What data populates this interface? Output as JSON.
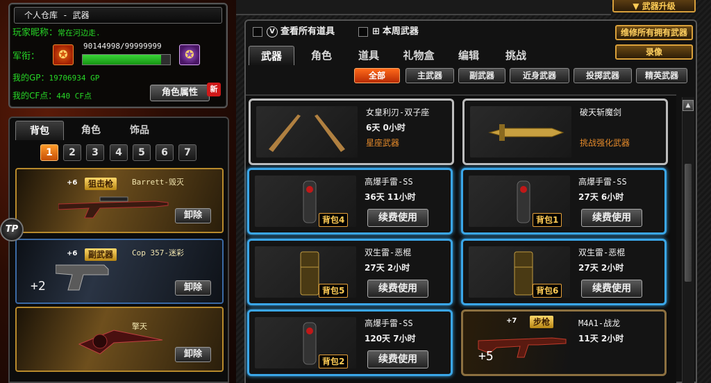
{
  "player": {
    "window_title": "个人仓库 - 武器",
    "nick_label": "玩家昵称：",
    "nick_value": "常在河边走.",
    "rank_label": "军衔：",
    "exp_text": "90144998/99999999",
    "exp_progress": 0.9,
    "gp_label": "我的GP：",
    "gp_value": "19706934 GP",
    "cf_label": "我的CF点：",
    "cf_value": "440 CF点",
    "role_button": "角色属性",
    "new_badge": "新"
  },
  "bag": {
    "tabs": [
      "背包",
      "角色",
      "饰品"
    ],
    "active_tab": 0,
    "pages": [
      "1",
      "2",
      "3",
      "4",
      "5",
      "6",
      "7"
    ],
    "active_page": 0,
    "tp_label": "TP",
    "slots": [
      {
        "plus": "+6",
        "tag": "狙击枪",
        "name": "Barrett-毁灭",
        "unload": "卸除",
        "extra": ""
      },
      {
        "plus": "+6",
        "tag": "副武器",
        "name": "Cop 357-迷彩",
        "unload": "卸除",
        "extra": "+2"
      },
      {
        "plus": "",
        "tag": "",
        "name": "擎天",
        "unload": "卸除",
        "extra": ""
      }
    ]
  },
  "header": {
    "top_button": "武器升级",
    "view_all": "查看所有道具",
    "weekly_weapon": "本周武器",
    "repair_all": "维修所有拥有武器",
    "record": "录像"
  },
  "main_tabs": [
    "武器",
    "角色",
    "道具",
    "礼物盒",
    "编辑",
    "挑战"
  ],
  "active_main_tab": 0,
  "filters": [
    "全部",
    "主武器",
    "副武器",
    "近身武器",
    "投掷武器",
    "精英武器"
  ],
  "active_filter": 0,
  "items": [
    {
      "name": "女皇利刃-双子座",
      "time": "6天  0小时",
      "sub": "星座武器",
      "style": "gray",
      "badge": "",
      "renew": ""
    },
    {
      "name": "破天斩魔剑",
      "time": "",
      "sub": "挑战强化武器",
      "style": "gray",
      "badge": "",
      "renew": ""
    },
    {
      "name": "高爆手雷-SS",
      "time": "36天  11小时",
      "sub": "",
      "style": "blue",
      "badge": "背包4",
      "renew": "续费使用"
    },
    {
      "name": "高爆手雷-SS",
      "time": "27天  6小时",
      "sub": "",
      "style": "blue",
      "badge": "背包1",
      "renew": "续费使用"
    },
    {
      "name": "双生雷-恶棍",
      "time": "27天  2小时",
      "sub": "",
      "style": "blue",
      "badge": "背包5",
      "renew": "续费使用"
    },
    {
      "name": "双生雷-恶棍",
      "time": "27天  2小时",
      "sub": "",
      "style": "blue",
      "badge": "背包6",
      "renew": "续费使用"
    },
    {
      "name": "高爆手雷-SS",
      "time": "120天  7小时",
      "sub": "",
      "style": "blue",
      "badge": "背包2",
      "renew": "续费使用"
    },
    {
      "name": "M4A1-战龙",
      "time": "11天  2小时",
      "sub": "",
      "style": "gold",
      "badge": "",
      "renew": "",
      "tag": "步枪",
      "plus": "+7",
      "extra": "+5"
    }
  ],
  "icons": {
    "scroll_up": "▲"
  }
}
